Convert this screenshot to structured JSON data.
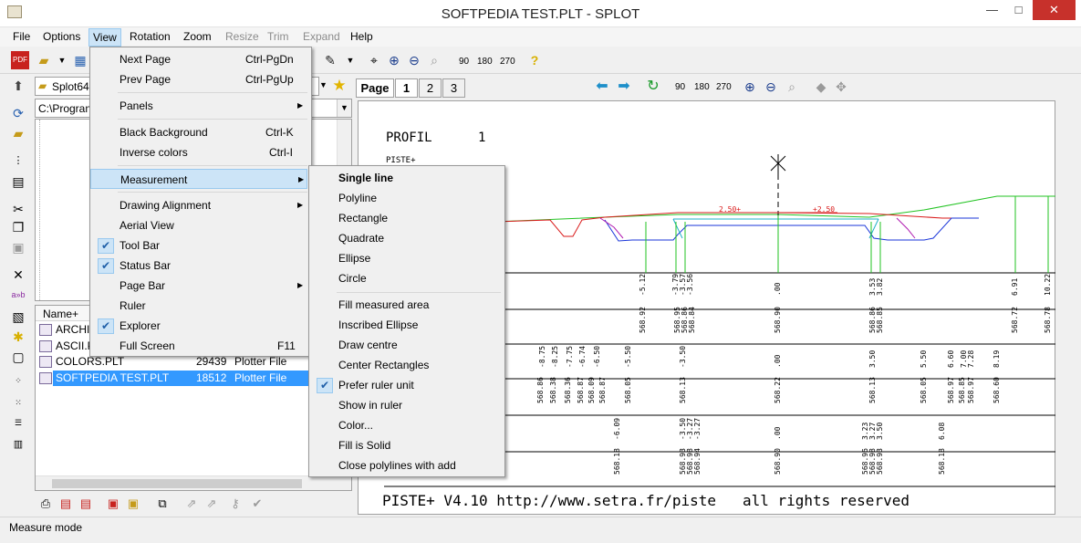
{
  "window": {
    "title": "SOFTPEDIA TEST.PLT - SPLOT",
    "min": "—",
    "max": "□",
    "close": "✕"
  },
  "menubar": [
    "File",
    "Options",
    "View",
    "Rotation",
    "Zoom",
    "Resize",
    "Trim",
    "Expand",
    "Help"
  ],
  "toolbar": {
    "rot90": "90",
    "rot180": "180",
    "rot270": "270"
  },
  "viewer_toolbar": {
    "page_label": "Page",
    "pages": [
      "1",
      "2",
      "3"
    ],
    "rot90": "90",
    "rot180": "180",
    "rot270": "270"
  },
  "left": {
    "folder_combo": "Splot64",
    "path_combo": "C:\\Progran",
    "list_header": {
      "name": "Name+"
    },
    "files": [
      {
        "name": "ARCHI",
        "size": "",
        "type": ""
      },
      {
        "name": "ASCII.P",
        "size": "",
        "type": ""
      },
      {
        "name": "COLORS.PLT",
        "size": "29439",
        "type": "Plotter File"
      },
      {
        "name": "SOFTPEDIA TEST.PLT",
        "size": "18512",
        "type": "Plotter File"
      }
    ]
  },
  "view_menu": {
    "items": [
      {
        "label": "Next Page",
        "shortcut": "Ctrl-PgDn"
      },
      {
        "label": "Prev Page",
        "shortcut": "Ctrl-PgUp"
      },
      {
        "label": "Panels",
        "shortcut": ""
      },
      {
        "label": "Black Background",
        "shortcut": "Ctrl-K"
      },
      {
        "label": "Inverse colors",
        "shortcut": "Ctrl-I"
      },
      {
        "label": "Measurement",
        "shortcut": ""
      },
      {
        "label": "Drawing Alignment",
        "shortcut": ""
      },
      {
        "label": "Aerial View",
        "shortcut": ""
      },
      {
        "label": "Tool Bar",
        "shortcut": ""
      },
      {
        "label": "Status Bar",
        "shortcut": ""
      },
      {
        "label": "Page Bar",
        "shortcut": ""
      },
      {
        "label": "Ruler",
        "shortcut": ""
      },
      {
        "label": "Explorer",
        "shortcut": ""
      },
      {
        "label": "Full Screen",
        "shortcut": "F11"
      }
    ],
    "checked": [
      "Tool Bar",
      "Status Bar",
      "Explorer"
    ]
  },
  "measurement_menu": {
    "items": [
      "Single line",
      "Polyline",
      "Rectangle",
      "Quadrate",
      "Ellipse",
      "Circle",
      "Fill measured area",
      "Inscribed Ellipse",
      "Draw centre",
      "Center Rectangles",
      "Prefer ruler unit",
      "Show in ruler",
      "Color...",
      "Fill is Solid",
      "Close polylines with add"
    ],
    "checked": [
      "Prefer ruler unit"
    ]
  },
  "plot": {
    "title": "PROFIL",
    "number": "1",
    "subtitle": "PISTE+",
    "dim_left": "2.50+",
    "dim_right": "+2.50",
    "footer": "PISTE+ V4.10 http://www.setra.fr/piste   all rights reserved",
    "row1": [
      "-5.12",
      "-3.79",
      "-3.57",
      "-3.56",
      ".00",
      "3.53",
      "3.82",
      "6.91",
      "10.22"
    ],
    "row2": [
      "568.92",
      "568.95",
      "568.86",
      "568.84",
      "568.90",
      "568.86",
      "568.85",
      "568.72",
      "568.78"
    ],
    "row3": [
      "-8.75",
      "-8.25",
      "-7.75",
      "-6.74",
      "-6.50",
      "-5.50",
      "-3.50",
      ".00",
      "3.50",
      "5.50",
      "6.60",
      "7.00",
      "7.28",
      "8.19"
    ],
    "row4": [
      "568.86",
      "568.38",
      "568.36",
      "568.87",
      "568.09",
      "568.87",
      "568.05",
      "568.13",
      "568.22",
      "568.13",
      "568.05",
      "568.97",
      "568.85",
      "568.97",
      "568.60"
    ],
    "row5": [
      "-6.09",
      "-3.50",
      "-3.27",
      "-3.27",
      ".00",
      "3.23",
      "3.27",
      "3.50",
      "6.08"
    ],
    "row6": [
      "568.18",
      "568.93",
      "568.98",
      "568.94",
      "568.90",
      "568.96",
      "568.98",
      "568.93",
      "568.18"
    ]
  },
  "status": {
    "text": "Measure mode"
  },
  "colors": {
    "menu_highlight": "#cce4f7",
    "close_button": "#c7312b",
    "plot_green": "#22c322",
    "plot_red": "#d91a1a",
    "plot_blue": "#1a36d9"
  }
}
